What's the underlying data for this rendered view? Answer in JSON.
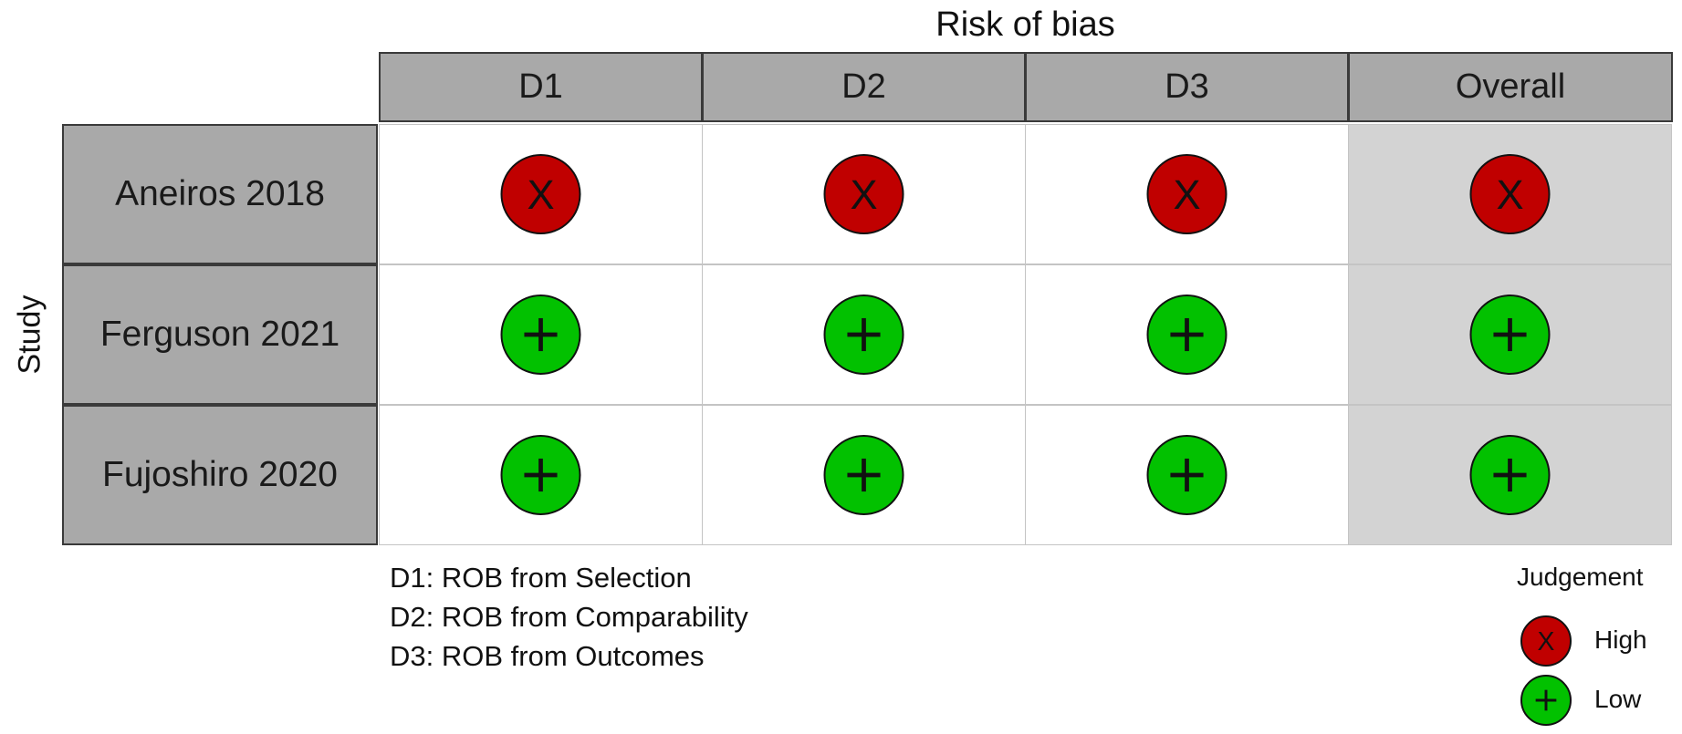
{
  "chart_data": {
    "type": "table",
    "title": "Risk of bias",
    "ylabel": "Study",
    "columns": [
      "D1",
      "D2",
      "D3",
      "Overall"
    ],
    "rows": [
      {
        "study": "Aneiros 2018",
        "judgements": [
          "High",
          "High",
          "High",
          "High"
        ]
      },
      {
        "study": "Ferguson 2021",
        "judgements": [
          "Low",
          "Low",
          "Low",
          "Low"
        ]
      },
      {
        "study": "Fujoshiro 2020",
        "judgements": [
          "Low",
          "Low",
          "Low",
          "Low"
        ]
      }
    ],
    "domain_legend": [
      "D1: ROB from Selection",
      "D2: ROB from Comparability",
      "D3: ROB from Outcomes"
    ],
    "judgement_legend": {
      "title": "Judgement",
      "position": "bottom-right",
      "items": [
        {
          "label": "High",
          "symbol": "X",
          "color": "#C00000"
        },
        {
          "label": "Low",
          "symbol": "+",
          "color": "#02C100"
        }
      ]
    }
  }
}
